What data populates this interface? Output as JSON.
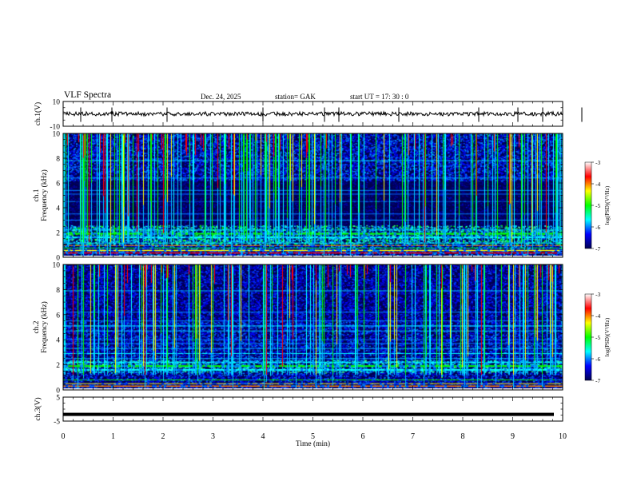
{
  "header": {
    "title": "VLF  Spectra",
    "date": "Dec. 24,  2025",
    "station": "station= GAK",
    "start": "start  UT  =    17: 30 : 0"
  },
  "chart_data": [
    {
      "type": "line",
      "panel": "ch1-waveform",
      "ylabel": "ch.1(V)",
      "ylim": [
        -10,
        10
      ],
      "yticks": [
        "10",
        "-10"
      ],
      "level": 0,
      "xlim": [
        0,
        10
      ],
      "line_color": "#000000"
    },
    {
      "type": "heatmap",
      "panel": "ch1-spectrogram",
      "ylabel_line1": "ch.1",
      "ylabel_line2": "Frequency  (kHz)",
      "ylim": [
        0,
        10
      ],
      "yticks": [
        "0",
        "2",
        "4",
        "6",
        "8",
        "10"
      ],
      "xlim": [
        0,
        10
      ],
      "colorbar": {
        "label": "log(PSD)(V²/Hz)",
        "range": [
          -7,
          -3
        ],
        "ticks": [
          "-3",
          "-4",
          "-5",
          "-6",
          "-7"
        ],
        "colors": [
          "#000050",
          "#0000ff",
          "#00ffff",
          "#00ff00",
          "#ffff00",
          "#ff0000",
          "#ffffff"
        ]
      }
    },
    {
      "type": "heatmap",
      "panel": "ch2-spectrogram",
      "ylabel_line1": "ch.2",
      "ylabel_line2": "Frequency  (kHz)",
      "ylim": [
        0,
        10
      ],
      "yticks": [
        "0",
        "2",
        "4",
        "6",
        "8",
        "10"
      ],
      "xlim": [
        0,
        10
      ],
      "colorbar": {
        "label": "log(PSD)(V²/Hz)",
        "range": [
          -7,
          -3
        ],
        "ticks": [
          "-3",
          "-4",
          "-5",
          "-6",
          "-7"
        ],
        "colors": [
          "#000050",
          "#0000ff",
          "#00ffff",
          "#00ff00",
          "#ffff00",
          "#ff0000",
          "#ffffff"
        ]
      }
    },
    {
      "type": "line",
      "panel": "ch3-waveform",
      "ylabel": "ch.3(V)",
      "ylim": [
        -5,
        5
      ],
      "yticks": [
        "5",
        "-5"
      ],
      "level": -2.2,
      "xlim": [
        0,
        10
      ],
      "xlabel": "Time  (min)",
      "xticks": [
        "0",
        "1",
        "2",
        "3",
        "4",
        "5",
        "6",
        "7",
        "8",
        "9",
        "10"
      ],
      "line_color": "#000000"
    }
  ]
}
